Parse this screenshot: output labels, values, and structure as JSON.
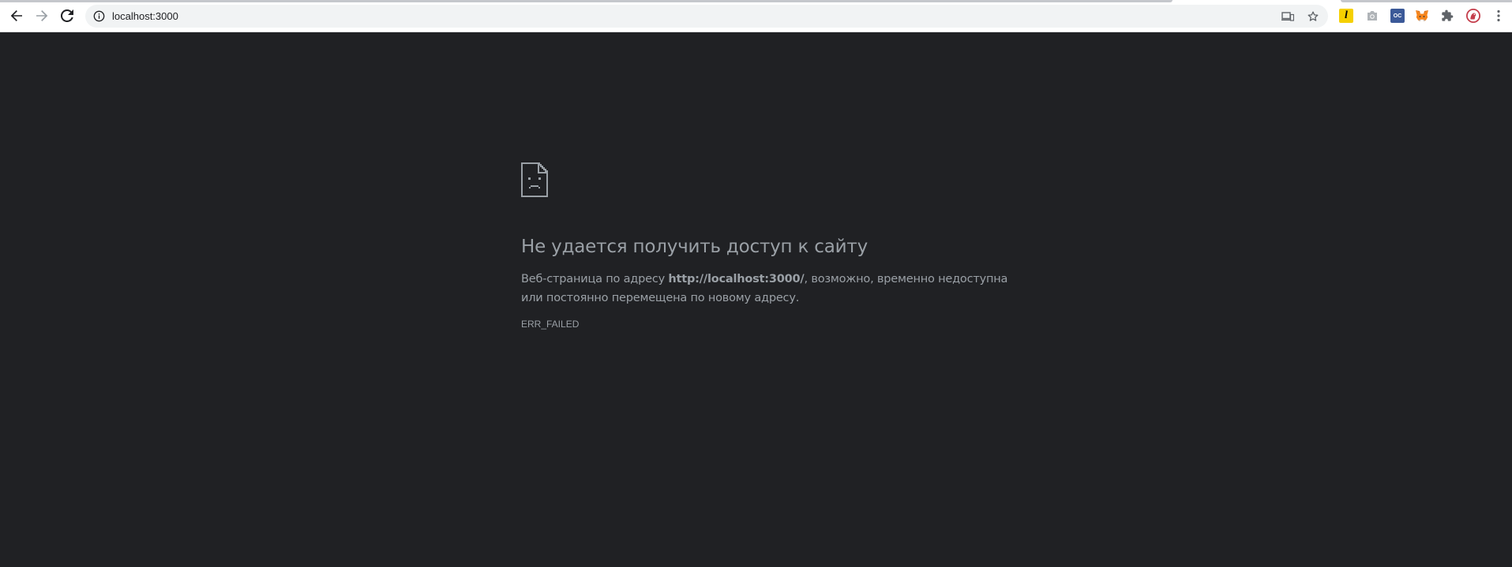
{
  "browser": {
    "url": "localhost:3000",
    "extensions": [
      {
        "name": "yellow-l-extension-icon",
        "letter": "l",
        "bg": "#f5d000",
        "fg": "#000000"
      },
      {
        "name": "camera-extension-icon",
        "letter": "",
        "bg": "transparent",
        "fg": "#9aa0a6"
      },
      {
        "name": "oc-extension-icon",
        "letter": "OC",
        "bg": "#3b5998",
        "fg": "#ffffff"
      },
      {
        "name": "metamask-fox-icon",
        "letter": "",
        "bg": "transparent",
        "fg": "#e2761b"
      },
      {
        "name": "extensions-puzzle-icon",
        "letter": "",
        "bg": "transparent",
        "fg": "#5f6368"
      },
      {
        "name": "profile-avatar-icon",
        "letter": "",
        "bg": "transparent",
        "fg": "#c43d4b"
      }
    ]
  },
  "error": {
    "title": "Не удается получить доступ к сайту",
    "body_prefix": "Веб-страница по адресу ",
    "body_url": "http://localhost:3000/",
    "body_suffix": ", возможно, временно недоступна или постоянно перемещена по новому адресу.",
    "code": "ERR_FAILED"
  },
  "colors": {
    "page_background": "#202124",
    "text": "#9aa0a6",
    "toolbar": "#ffffff",
    "omnibox": "#f1f3f4"
  }
}
